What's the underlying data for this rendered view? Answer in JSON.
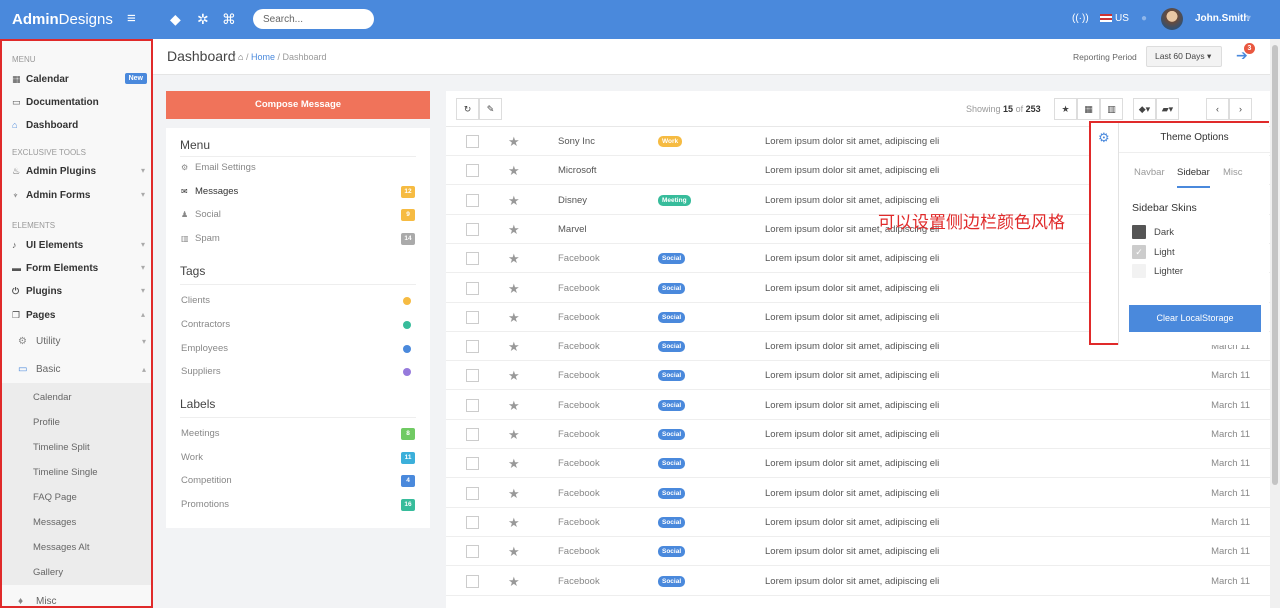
{
  "topbar": {
    "brand_bold": "Admin",
    "brand_rest": "Designs",
    "search_placeholder": "Search...",
    "language": "US",
    "user": "John.Smith"
  },
  "sidebar": {
    "menu_header": "MENU",
    "menu": [
      {
        "label": "Calendar",
        "badge": "New"
      },
      {
        "label": "Documentation"
      },
      {
        "label": "Dashboard"
      }
    ],
    "tools_header": "EXCLUSIVE TOOLS",
    "tools": [
      {
        "label": "Admin Plugins"
      },
      {
        "label": "Admin Forms"
      }
    ],
    "elements_header": "ELEMENTS",
    "elements": [
      {
        "label": "UI Elements"
      },
      {
        "label": "Form Elements"
      },
      {
        "label": "Plugins"
      },
      {
        "label": "Pages"
      }
    ],
    "sub": [
      {
        "label": "Utility"
      },
      {
        "label": "Basic"
      }
    ],
    "basic_items": [
      "Calendar",
      "Profile",
      "Timeline Split",
      "Timeline Single",
      "FAQ Page",
      "Messages",
      "Messages Alt",
      "Gallery"
    ],
    "misc": "Misc"
  },
  "header": {
    "title": "Dashboard",
    "crumb_home": "Home",
    "crumb_current": "Dashboard",
    "reporting_label": "Reporting Period",
    "reporting_value": "Last 60 Days",
    "exit_badge": "3"
  },
  "left_panel": {
    "compose": "Compose Message",
    "menu_title": "Menu",
    "menu_items": [
      {
        "label": "Email Settings",
        "badge": ""
      },
      {
        "label": "Messages",
        "badge": "12"
      },
      {
        "label": "Social",
        "badge": "9"
      },
      {
        "label": "Spam",
        "badge": "14"
      }
    ],
    "tags_title": "Tags",
    "tags": [
      "Clients",
      "Contractors",
      "Employees",
      "Suppliers"
    ],
    "labels_title": "Labels",
    "labels": [
      {
        "label": "Meetings",
        "count": "8"
      },
      {
        "label": "Work",
        "count": "11"
      },
      {
        "label": "Competition",
        "count": "4"
      },
      {
        "label": "Promotions",
        "count": "16"
      }
    ]
  },
  "mail": {
    "showing_prefix": "Showing",
    "showing_count": "15",
    "showing_of": "of",
    "showing_total": "253",
    "rows": [
      {
        "sender": "Sony Inc",
        "tag": "Work",
        "subject": "Lorem ipsum dolor sit amet, adipiscing eli",
        "date": ""
      },
      {
        "sender": "Microsoft",
        "tag": "",
        "subject": "Lorem ipsum dolor sit amet, adipiscing eli",
        "date": ""
      },
      {
        "sender": "Disney",
        "tag": "Meeting",
        "subject": "Lorem ipsum dolor sit amet, adipiscing eli",
        "date": ""
      },
      {
        "sender": "Marvel",
        "tag": "",
        "subject": "Lorem ipsum dolor sit amet, adipiscing eli",
        "date": ""
      },
      {
        "sender": "Facebook",
        "tag": "Social",
        "subject": "Lorem ipsum dolor sit amet, adipiscing eli",
        "date": ""
      },
      {
        "sender": "Facebook",
        "tag": "Social",
        "subject": "Lorem ipsum dolor sit amet, adipiscing eli",
        "date": ""
      },
      {
        "sender": "Facebook",
        "tag": "Social",
        "subject": "Lorem ipsum dolor sit amet, adipiscing eli",
        "date": ""
      },
      {
        "sender": "Facebook",
        "tag": "Social",
        "subject": "Lorem ipsum dolor sit amet, adipiscing eli",
        "date": "March 11"
      },
      {
        "sender": "Facebook",
        "tag": "Social",
        "subject": "Lorem ipsum dolor sit amet, adipiscing eli",
        "date": "March 11"
      },
      {
        "sender": "Facebook",
        "tag": "Social",
        "subject": "Lorem ipsum dolor sit amet, adipiscing eli",
        "date": "March 11"
      },
      {
        "sender": "Facebook",
        "tag": "Social",
        "subject": "Lorem ipsum dolor sit amet, adipiscing eli",
        "date": "March 11"
      },
      {
        "sender": "Facebook",
        "tag": "Social",
        "subject": "Lorem ipsum dolor sit amet, adipiscing eli",
        "date": "March 11"
      },
      {
        "sender": "Facebook",
        "tag": "Social",
        "subject": "Lorem ipsum dolor sit amet, adipiscing eli",
        "date": "March 11"
      },
      {
        "sender": "Facebook",
        "tag": "Social",
        "subject": "Lorem ipsum dolor sit amet, adipiscing eli",
        "date": "March 11"
      },
      {
        "sender": "Facebook",
        "tag": "Social",
        "subject": "Lorem ipsum dolor sit amet, adipiscing eli",
        "date": "March 11"
      },
      {
        "sender": "Facebook",
        "tag": "Social",
        "subject": "Lorem ipsum dolor sit amet, adipiscing eli",
        "date": "March 11"
      }
    ]
  },
  "theme": {
    "title": "Theme Options",
    "tabs": [
      "Navbar",
      "Sidebar",
      "Misc"
    ],
    "skins_title": "Sidebar Skins",
    "skins": [
      "Dark",
      "Light",
      "Lighter"
    ],
    "clear": "Clear LocalStorage"
  },
  "annotation": "可以设置侧边栏颜色风格",
  "colors": {
    "primary": "#4a89dc",
    "compose": "#f0735a",
    "highlight": "#e02a2a",
    "tag_work": "#f6bb42",
    "tag_meeting": "#37bc9b",
    "tag_social": "#4a89dc"
  }
}
